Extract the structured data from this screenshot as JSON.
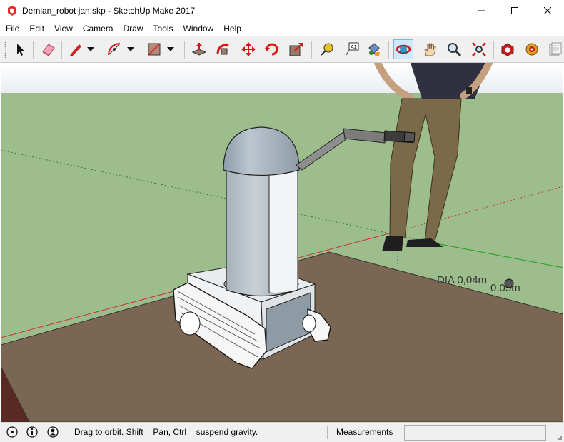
{
  "window": {
    "title": "Demian_robot jan.skp - SketchUp Make 2017",
    "minimize_glyph": "—",
    "maximize_glyph": "☐",
    "close_glyph": "✕"
  },
  "menu": [
    "File",
    "Edit",
    "View",
    "Camera",
    "Draw",
    "Tools",
    "Window",
    "Help"
  ],
  "toolbar": {
    "active_tool": "orbit",
    "tools": [
      "select",
      "eraser",
      "pencil",
      "arc",
      "rectangle",
      "push-pull",
      "follow-me",
      "move",
      "rotate",
      "scale",
      "tape-measure",
      "text",
      "paint-bucket",
      "orbit",
      "pan",
      "zoom",
      "zoom-extents",
      "warehouse",
      "extension-warehouse",
      "layout"
    ]
  },
  "viewport": {
    "dimension_label": "DIA 0,04m",
    "dimension_label_2": "0,05m",
    "sky_color": "#ffffff",
    "ground_color": "#9dbd8d",
    "floor_color": "#7a6652"
  },
  "status": {
    "hint": "Drag to orbit. Shift = Pan, Ctrl = suspend gravity.",
    "measurements_label": "Measurements",
    "measurements_value": ""
  }
}
